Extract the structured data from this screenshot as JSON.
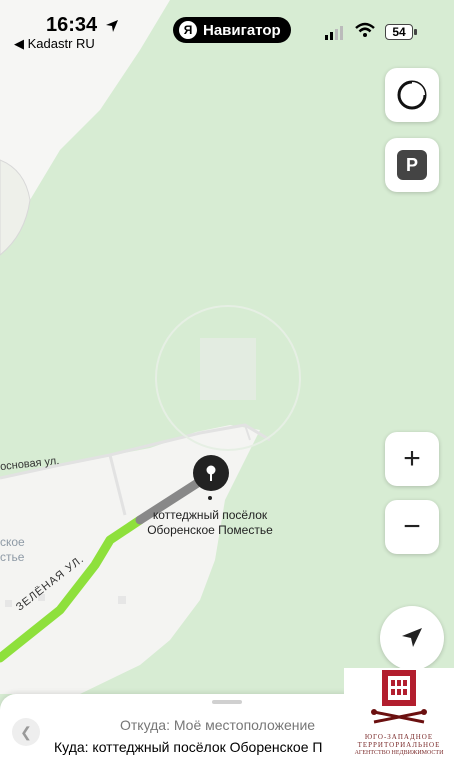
{
  "status_bar": {
    "time": "16:34",
    "back_app": "◀ Kadastr RU",
    "battery": "54"
  },
  "app": {
    "name": "Навигатор",
    "logo_letter": "Я"
  },
  "map": {
    "destination_label_line1": "коттеджный посёлок",
    "destination_label_line2": "Оборенское Поместье",
    "streets": {
      "sosnovaya": "основая ул.",
      "zelenaya": "Зелёная ул."
    },
    "district_partial_line1": "ское",
    "district_partial_line2": "стье",
    "route_color": "#8ee03c",
    "route_end_color": "#888888"
  },
  "controls": {
    "zoom_in": "+",
    "zoom_out": "−",
    "parking": "P"
  },
  "route_sheet": {
    "from": "Откуда: Моё местоположение",
    "to": "Куда: коттеджный посёлок Оборенское П"
  },
  "watermark": {
    "text_line1": "ЮГО-ЗАПАДНОЕ",
    "text_line2": "ТЕРРИТОРИАЛЬНОЕ",
    "text_line3": "АГЕНТСТВО НЕДВИЖИМОСТИ"
  }
}
